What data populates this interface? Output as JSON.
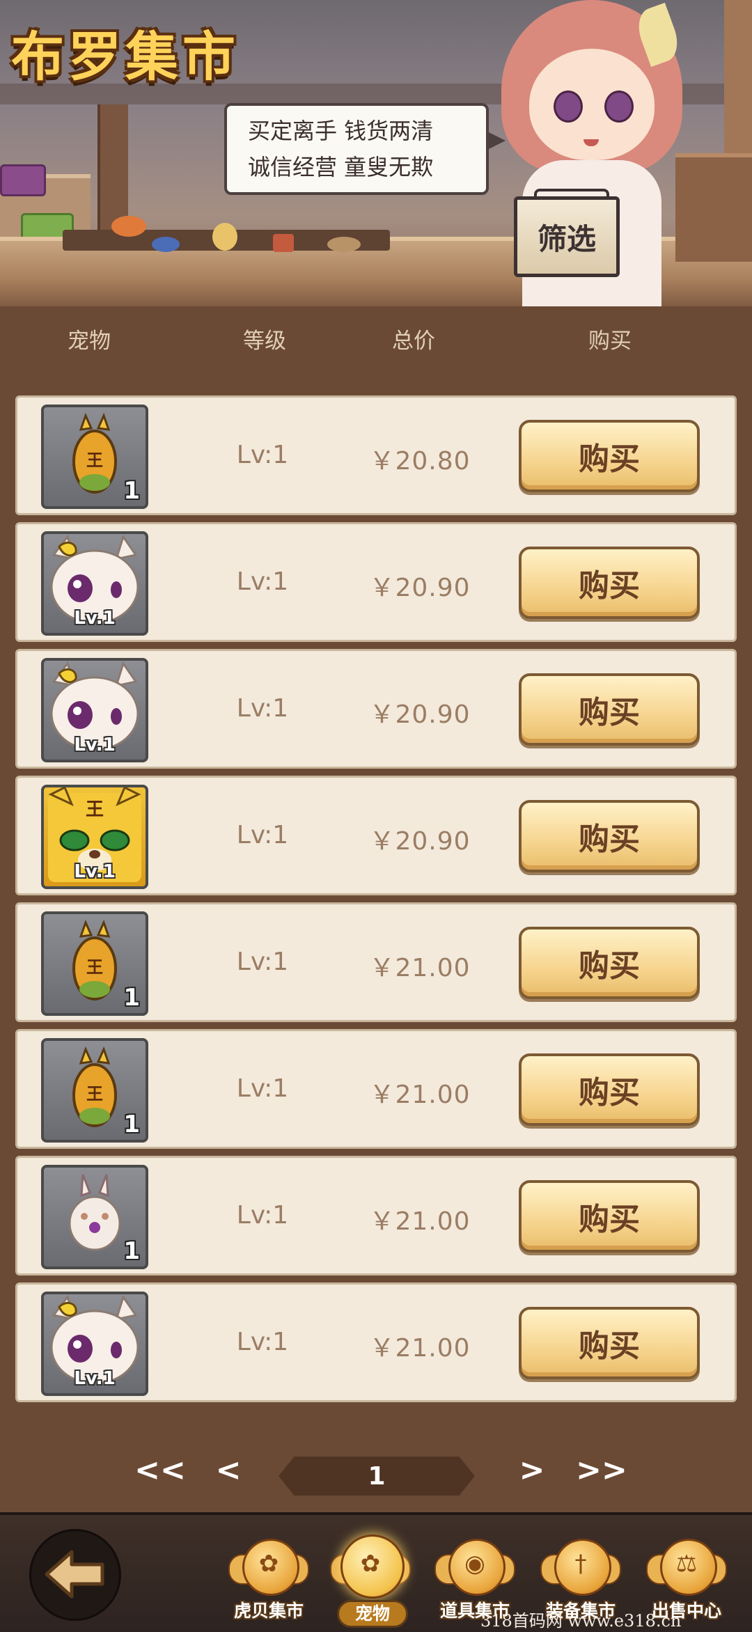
{
  "header": {
    "title": "布罗集市",
    "speech_lines": [
      "买定离手 钱货两清",
      "诚信经营 童叟无欺"
    ],
    "filter_label": "筛选"
  },
  "columns": {
    "pet": "宠物",
    "level": "等级",
    "total_price": "总价",
    "buy": "购买"
  },
  "listings": [
    {
      "icon": "tiger-egg-icon",
      "badge": "1",
      "level": "Lv:1",
      "price": "￥20.80",
      "buy_label": "购买"
    },
    {
      "icon": "bunny-pet-icon",
      "badge": "Lv.1",
      "level": "Lv:1",
      "price": "￥20.90",
      "buy_label": "购买"
    },
    {
      "icon": "bunny-pet-icon",
      "badge": "Lv.1",
      "level": "Lv:1",
      "price": "￥20.90",
      "buy_label": "购买"
    },
    {
      "icon": "tiger-pet-icon",
      "badge": "Lv.1",
      "level": "Lv:1",
      "price": "￥20.90",
      "buy_label": "购买"
    },
    {
      "icon": "tiger-egg-icon",
      "badge": "1",
      "level": "Lv:1",
      "price": "￥21.00",
      "buy_label": "购买"
    },
    {
      "icon": "tiger-egg-icon",
      "badge": "1",
      "level": "Lv:1",
      "price": "￥21.00",
      "buy_label": "购买"
    },
    {
      "icon": "rabbit-egg-icon",
      "badge": "1",
      "level": "Lv:1",
      "price": "￥21.00",
      "buy_label": "购买"
    },
    {
      "icon": "bunny-pet-icon",
      "badge": "Lv.1",
      "level": "Lv:1",
      "price": "￥21.00",
      "buy_label": "购买"
    }
  ],
  "pagination": {
    "first": "<<",
    "prev": "<",
    "current_page": "1",
    "next": ">",
    "last": ">>"
  },
  "bottom_nav": {
    "back_icon": "back-arrow-icon",
    "items": [
      {
        "label": "虎贝集市",
        "icon": "paw-icon",
        "active": false
      },
      {
        "label": "宠物",
        "icon": "paw-icon",
        "active": true
      },
      {
        "label": "道具集市",
        "icon": "bag-icon",
        "active": false
      },
      {
        "label": "装备集市",
        "icon": "sword-icon",
        "active": false
      },
      {
        "label": "出售中心",
        "icon": "scale-icon",
        "active": false
      }
    ]
  },
  "watermark": "318首码网 www.e318.cn",
  "colors": {
    "background": "#6b4a35",
    "row_bg": "#f3eadc",
    "buy_button": "#f6d48e",
    "title": "#ffd35a",
    "price_text": "#9b7d64"
  }
}
